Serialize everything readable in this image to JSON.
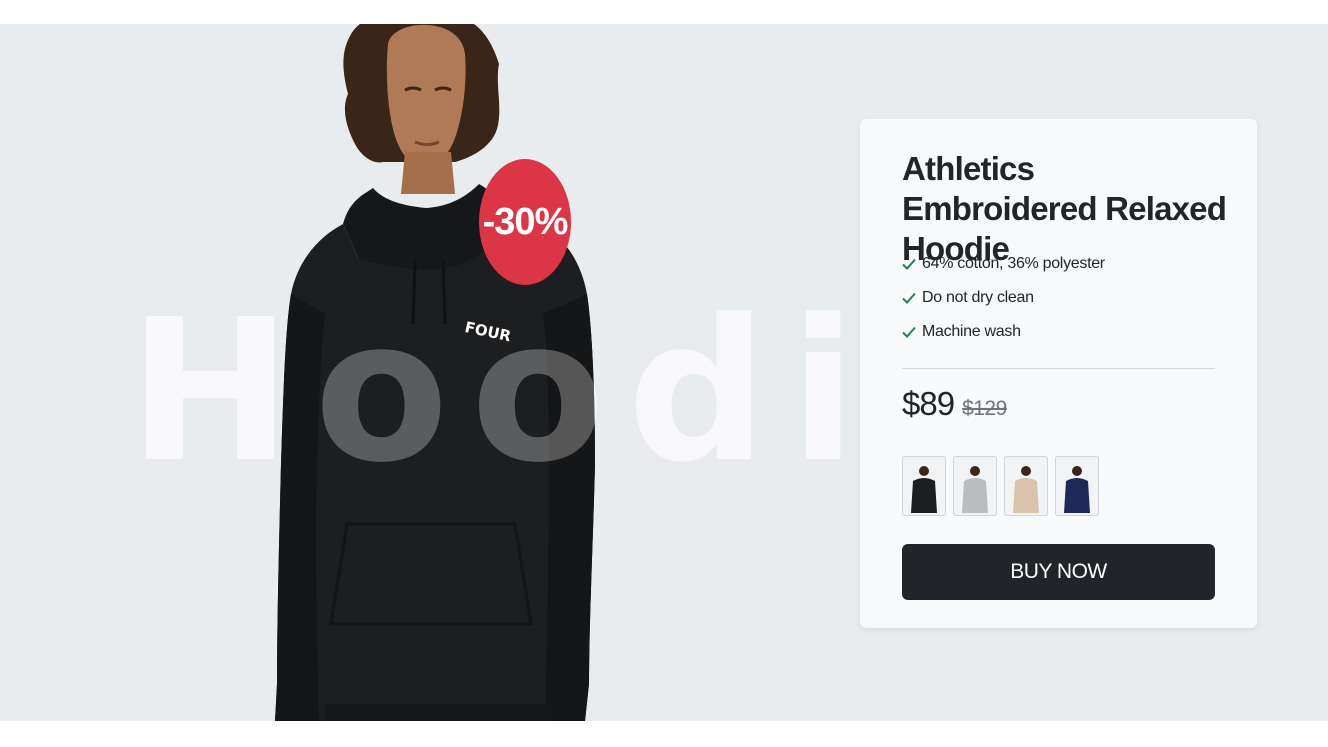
{
  "hero": {
    "watermark_text": "Hoodie",
    "discount_badge": "-30%",
    "badge_color": "#dc3545",
    "background_color": "#e9ecef",
    "hoodie_color": "#1d1e20",
    "logo_text": "FOUR"
  },
  "product": {
    "title": "Athletics Embroidered Relaxed Hoodie",
    "features": [
      "64% cotton, 36% polyester",
      "Do not dry clean",
      "Machine wash"
    ],
    "check_color": "#198754",
    "price": "$89",
    "old_price": "$129",
    "swatches": [
      {
        "name": "black",
        "color": "#1d1e20"
      },
      {
        "name": "grey",
        "color": "#b9bcc0"
      },
      {
        "name": "beige",
        "color": "#d9c4ab"
      },
      {
        "name": "navy",
        "color": "#1f2a5c"
      }
    ],
    "buy_label": "BUY NOW",
    "buy_color": "#212529"
  }
}
